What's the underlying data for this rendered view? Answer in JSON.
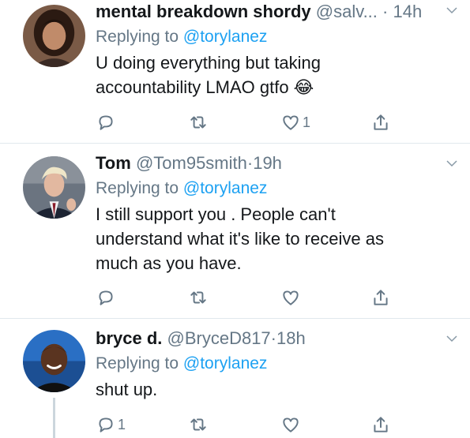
{
  "tweets": [
    {
      "name": "mental breakdown shordy",
      "handle": "@salv...",
      "dot": "·",
      "time": "14h",
      "replying_prefix": "Replying to ",
      "replying_to": "@torylanez",
      "text_lines": [
        "U doing everything but taking",
        "accountability LMAO gtfo 😂"
      ],
      "reply_count": "",
      "retweet_count": "",
      "like_count": "1"
    },
    {
      "name": "Tom",
      "handle": "@Tom95smith",
      "dot": "·",
      "time": "19h",
      "replying_prefix": "Replying to ",
      "replying_to": "@torylanez",
      "text_lines": [
        "I still support you . People can't",
        "understand what it's like to receive as",
        "much as you have."
      ],
      "reply_count": "",
      "retweet_count": "",
      "like_count": ""
    },
    {
      "name": "bryce d.",
      "handle": "@BryceD817",
      "dot": "·",
      "time": "18h",
      "replying_prefix": "Replying to ",
      "replying_to": "@torylanez",
      "text_lines": [
        "shut up."
      ],
      "reply_count": "1",
      "retweet_count": "",
      "like_count": ""
    }
  ],
  "colors": {
    "link": "#1da1f2",
    "secondary_text": "#657786",
    "divider": "#e1e8ed"
  },
  "icons": [
    "reply-icon",
    "retweet-icon",
    "like-icon",
    "share-icon",
    "chevron-down-icon"
  ]
}
